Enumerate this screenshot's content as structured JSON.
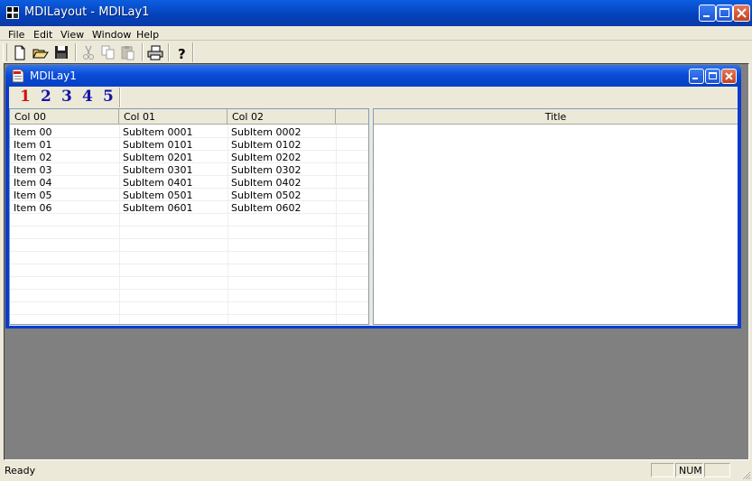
{
  "app": {
    "title": "MDILayout - MDILay1"
  },
  "menu": {
    "items": [
      "File",
      "Edit",
      "View",
      "Window",
      "Help"
    ]
  },
  "toolbar": {
    "buttons": [
      "new-icon",
      "open-icon",
      "save-icon",
      "cut-icon",
      "copy-icon",
      "paste-icon",
      "print-icon",
      "help-icon"
    ]
  },
  "child_window": {
    "title": "MDILay1",
    "tabs": [
      "1",
      "2",
      "3",
      "4",
      "5"
    ],
    "active_tab": "1"
  },
  "list": {
    "columns": [
      "Col 00",
      "Col 01",
      "Col 02"
    ],
    "rows": [
      [
        "Item 00",
        "SubItem 0001",
        "SubItem 0002"
      ],
      [
        "Item 01",
        "SubItem 0101",
        "SubItem 0102"
      ],
      [
        "Item 02",
        "SubItem 0201",
        "SubItem 0202"
      ],
      [
        "Item 03",
        "SubItem 0301",
        "SubItem 0302"
      ],
      [
        "Item 04",
        "SubItem 0401",
        "SubItem 0402"
      ],
      [
        "Item 05",
        "SubItem 0501",
        "SubItem 0502"
      ],
      [
        "Item 06",
        "SubItem 0601",
        "SubItem 0602"
      ]
    ]
  },
  "right_pane": {
    "header": "Title"
  },
  "status": {
    "text": "Ready",
    "num": "NUM"
  },
  "colors": {
    "title_blue": "#0441b9",
    "face": "#ece9d8",
    "mdi_background": "#808080",
    "active_tab": "#d01010",
    "inactive_tab": "#1515a8"
  }
}
